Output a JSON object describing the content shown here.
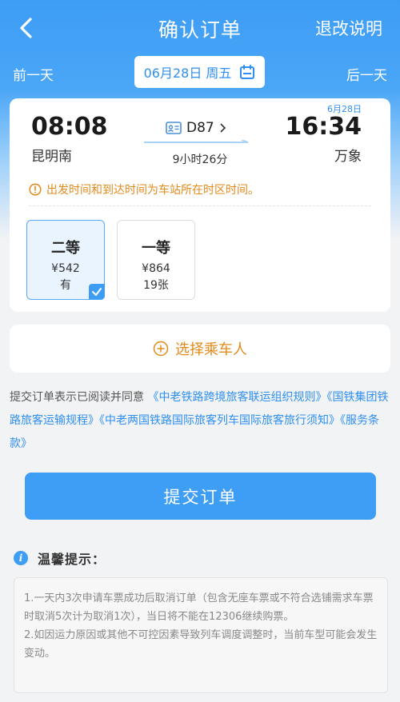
{
  "header": {
    "title": "确认订单",
    "refund_label": "退改说明",
    "prev_day": "前一天",
    "next_day": "后一天",
    "date": "06月28日 周五"
  },
  "train": {
    "dep_time": "08:08",
    "dep_station": "昆明南",
    "arr_date": "6月28日",
    "arr_time": "16:34",
    "arr_station": "万象",
    "number": "D87",
    "duration": "9小时26分",
    "notice": "出发时间和到达时间为车站所在时区时间。"
  },
  "seats": [
    {
      "class": "二等",
      "price": "¥542",
      "availability": "有",
      "selected": true
    },
    {
      "class": "一等",
      "price": "¥864",
      "availability": "19张",
      "selected": false
    }
  ],
  "passenger": {
    "label": "选择乘车人"
  },
  "agreement": {
    "prefix": "提交订单表示已阅读并同意",
    "link1": "《中老铁路跨境旅客联运组织规则》",
    "link2": "《国铁集团铁路旅客运输规程》",
    "link3": "《中老两国铁路国际旅客列车国际旅客旅行须知》",
    "link4": "《服务条款》"
  },
  "submit": {
    "label": "提交订单"
  },
  "tips": {
    "title": "温馨提示：",
    "item1": "1.一天内3次申请车票成功后取消订单（包含无座车票或不符合选铺需求车票时取消5次计为取消1次），当日将不能在12306继续购票。",
    "item2": "2.如因运力原因或其他不可控因素导致列车调度调整时，当前车型可能会发生变动。"
  },
  "colors": {
    "brand_blue": "#3e9ef5",
    "notice_orange": "#e28a1a",
    "link_blue": "#2f8ff0"
  },
  "icons": {
    "back": "chevron-left-icon",
    "calendar": "calendar-icon",
    "train": "id-card-icon",
    "warning": "exclamation-circle-icon",
    "add": "plus-circle-icon",
    "info": "info-icon",
    "check": "check-icon"
  }
}
